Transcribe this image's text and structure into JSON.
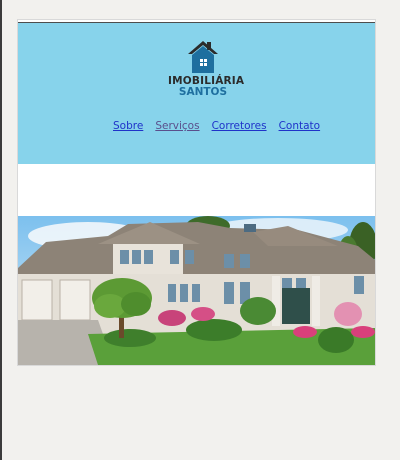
{
  "brand": {
    "name_line1": "IMOBILIÁRIA",
    "name_line2": "SANTOS",
    "logo_icon": "house-logo-icon"
  },
  "nav": {
    "items": [
      {
        "label": "Sobre"
      },
      {
        "label": "Serviços"
      },
      {
        "label": "Corretores"
      },
      {
        "label": "Contato"
      }
    ]
  },
  "hero": {
    "image": "house-photo"
  },
  "colors": {
    "header_bg": "#87d3eb",
    "link": "#1f33c9",
    "visited_link": "#5a4f8c",
    "brand_blue": "#1e6f9f"
  }
}
